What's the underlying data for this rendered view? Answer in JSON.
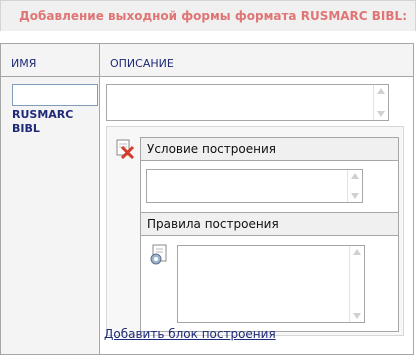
{
  "page": {
    "title": "Добавление выходной формы формата RUSMARC BIBL:"
  },
  "table": {
    "col_name_header": "ИМЯ",
    "col_desc_header": "ОПИСАНИЕ",
    "name_input_value": "",
    "name_text": "RUSMARC BIBL",
    "description_value": ""
  },
  "block": {
    "condition_header": "Условие построения",
    "condition_value": "",
    "rules_header": "Правила построения",
    "rules_value": ""
  },
  "links": {
    "add_block": "Добавить блок построения"
  },
  "colors": {
    "title": "#e07575",
    "link": "#1f2a78",
    "header_bg": "#f4f4f4"
  },
  "icons": {
    "delete": "delete-x-icon",
    "rules": "gear-document-icon"
  }
}
